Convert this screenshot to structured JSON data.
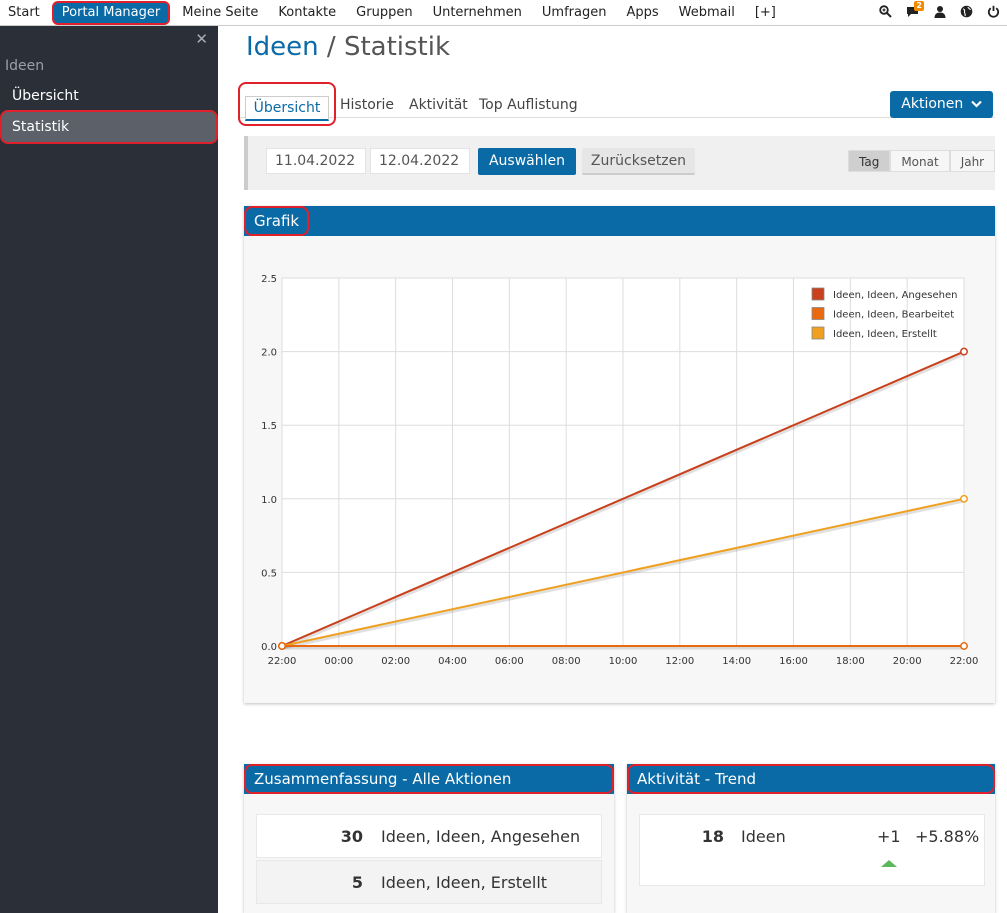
{
  "topnav": {
    "items": [
      "Start",
      "Portal Manager",
      "Meine Seite",
      "Kontakte",
      "Gruppen",
      "Unternehmen",
      "Umfragen",
      "Apps",
      "Webmail",
      "[+]"
    ],
    "active": "Portal Manager",
    "notification_count": "2"
  },
  "sidebar": {
    "section": "Ideen",
    "items": [
      "Übersicht",
      "Statistik"
    ],
    "active": "Statistik",
    "close_glyph": "✕"
  },
  "page": {
    "title_main": "Ideen",
    "title_sep": "/",
    "title_sub": "Statistik"
  },
  "tabs": {
    "items": [
      "Übersicht",
      "Historie",
      "Aktivität",
      "Top Auflistung"
    ],
    "active": "Übersicht",
    "actions_label": "Aktionen"
  },
  "filter": {
    "date_from": "11.04.2022",
    "date_to": "12.04.2022",
    "select_label": "Auswählen",
    "reset_label": "Zurücksetzen",
    "periods": [
      "Tag",
      "Monat",
      "Jahr"
    ],
    "active_period": "Tag"
  },
  "chart_panel": {
    "title": "Grafik"
  },
  "chart_data": {
    "type": "line",
    "title": "",
    "xlabel": "",
    "ylabel": "",
    "categories": [
      "22:00",
      "00:00",
      "02:00",
      "04:00",
      "06:00",
      "08:00",
      "10:00",
      "12:00",
      "14:00",
      "16:00",
      "18:00",
      "20:00",
      "22:00"
    ],
    "yticks": [
      "0.0",
      "0.5",
      "1.0",
      "1.5",
      "2.0",
      "2.5"
    ],
    "ylim": [
      0,
      2.5
    ],
    "grid": true,
    "legend_position": "top-right",
    "series": [
      {
        "name": "Ideen, Ideen, Angesehen",
        "color": "#c8401c",
        "points": [
          [
            0,
            0
          ],
          [
            12,
            2
          ]
        ]
      },
      {
        "name": "Ideen, Ideen, Bearbeitet",
        "color": "#e8690f",
        "points": [
          [
            0,
            0
          ],
          [
            12,
            0
          ]
        ]
      },
      {
        "name": "Ideen, Ideen, Erstellt",
        "color": "#f0a020",
        "points": [
          [
            0,
            0
          ],
          [
            12,
            1
          ]
        ]
      }
    ]
  },
  "summary": {
    "title": "Zusammenfassung - Alle Aktionen",
    "rows": [
      {
        "count": "30",
        "label": "Ideen, Ideen, Angesehen"
      },
      {
        "count": "5",
        "label": "Ideen, Ideen, Erstellt"
      }
    ]
  },
  "trend": {
    "title": "Aktivität - Trend",
    "count": "18",
    "label": "Ideen",
    "delta": "+1",
    "percent": "+5.88%",
    "arrow_color": "#5cb85c"
  }
}
